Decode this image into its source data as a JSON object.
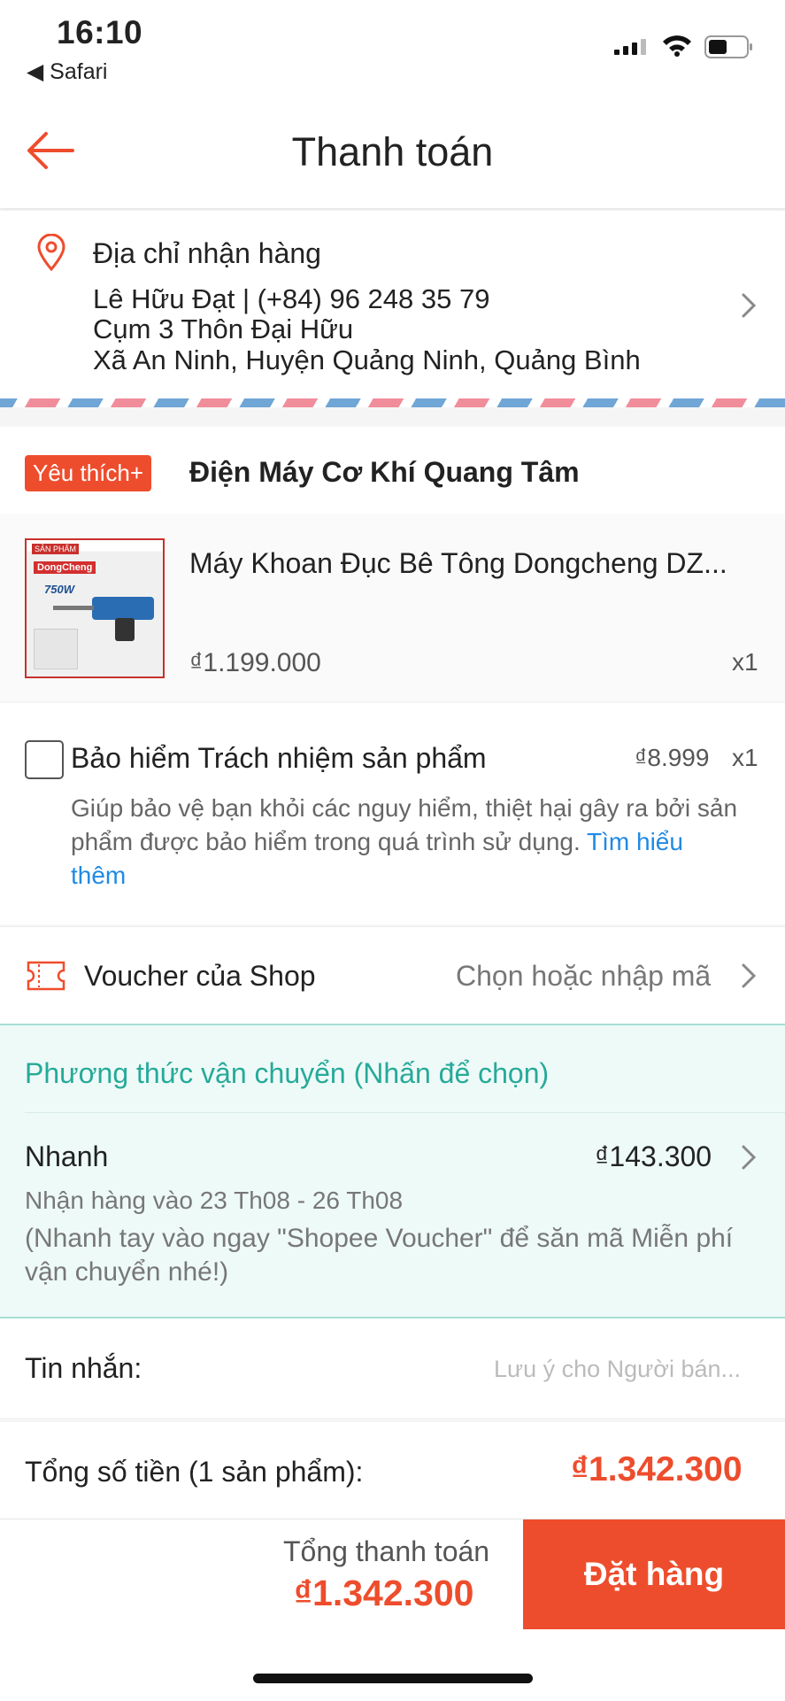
{
  "status_bar": {
    "time": "16:10",
    "back_app": "◀ Safari"
  },
  "header": {
    "title": "Thanh toán"
  },
  "address": {
    "label": "Địa chỉ nhận hàng",
    "name_phone": "Lê Hữu Đạt | (+84) 96 248 35 79",
    "line1": "Cụm 3 Thôn Đại Hữu",
    "line2": "Xã An Ninh, Huyện Quảng Ninh, Quảng Bình"
  },
  "shop": {
    "badge": "Yêu thích+",
    "name": "Điện Máy Cơ Khí Quang Tâm"
  },
  "product": {
    "name": "Máy Khoan Đục Bê Tông Dongcheng DZ...",
    "price": "₫1.199.000",
    "quantity": "x1",
    "thumb_brand": "DongCheng",
    "thumb_power": "750W"
  },
  "insurance": {
    "title": "Bảo hiểm Trách nhiệm sản phẩm",
    "price": "₫8.999",
    "quantity": "x1",
    "description": "Giúp bảo vệ bạn khỏi các nguy hiểm, thiệt hại gây ra bởi sản phẩm được bảo hiểm trong quá trình sử dụng.",
    "link": "Tìm hiểu thêm",
    "checked": false
  },
  "voucher": {
    "label": "Voucher của Shop",
    "hint": "Chọn hoặc nhập mã"
  },
  "shipping": {
    "title": "Phương thức vận chuyển (Nhấn để chọn)",
    "method": "Nhanh",
    "price": "₫143.300",
    "date": "Nhận hàng vào 23 Th08 - 26 Th08",
    "note": "(Nhanh tay vào ngay \"Shopee Voucher\" để săn mã Miễn phí vận chuyển nhé!)"
  },
  "message": {
    "label": "Tin nhắn:",
    "placeholder": "Lưu ý cho Người bán..."
  },
  "total": {
    "label": "Tổng số tiền (1 sản phẩm):",
    "value": "₫1.342.300"
  },
  "bottom_bar": {
    "label": "Tổng thanh toán",
    "value": "₫1.342.300",
    "order_button": "Đặt hàng"
  },
  "colors": {
    "accent": "#ee4d2d",
    "shipping_green": "#26aa99",
    "link_blue": "#1f8ae5"
  }
}
